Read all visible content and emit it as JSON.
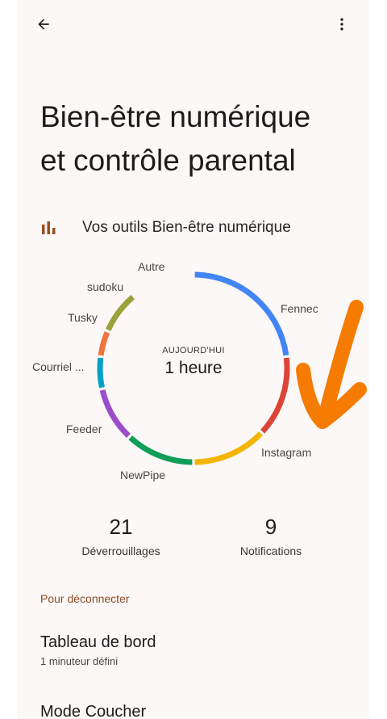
{
  "header": {
    "back_icon": "arrow-back-icon",
    "more_icon": "more-vert-icon"
  },
  "page": {
    "title_line1": "Bien-être numérique",
    "title_line2": "et contrôle parental"
  },
  "tools_section": {
    "icon": "bar-chart-icon",
    "label": "Vos outils Bien-être numérique"
  },
  "chart_data": {
    "type": "donut",
    "center_caption": "AUJOURD'HUI",
    "center_value": "1 heure",
    "segments": [
      {
        "label": "Fennec",
        "share": 0.23,
        "color": "#4285f4"
      },
      {
        "label": "Instagram",
        "share": 0.14,
        "color": "#db4437"
      },
      {
        "label": "NewPipe",
        "share": 0.13,
        "color": "#f4b400"
      },
      {
        "label": "Feeder",
        "share": 0.12,
        "color": "#0f9d58"
      },
      {
        "label": "Courriel ...",
        "share": 0.095,
        "color": "#9b4dca"
      },
      {
        "label": "Tusky",
        "share": 0.055,
        "color": "#00a2c2"
      },
      {
        "label": "sudoku",
        "share": 0.045,
        "color": "#f0743e"
      },
      {
        "label": "Autre",
        "share": 0.075,
        "color": "#9aa23a"
      }
    ]
  },
  "stats": {
    "unlocks_value": "21",
    "unlocks_label": "Déverrouillages",
    "notifications_value": "9",
    "notifications_label": "Notifications"
  },
  "disconnect": {
    "header": "Pour déconnecter",
    "items": [
      {
        "title": "Tableau de bord",
        "subtitle": "1 minuteur défini"
      },
      {
        "title": "Mode Coucher",
        "subtitle": ""
      }
    ]
  },
  "colors": {
    "accent": "#8a4a22",
    "annotation": "#f57c00",
    "background": "#fcf8f8"
  }
}
